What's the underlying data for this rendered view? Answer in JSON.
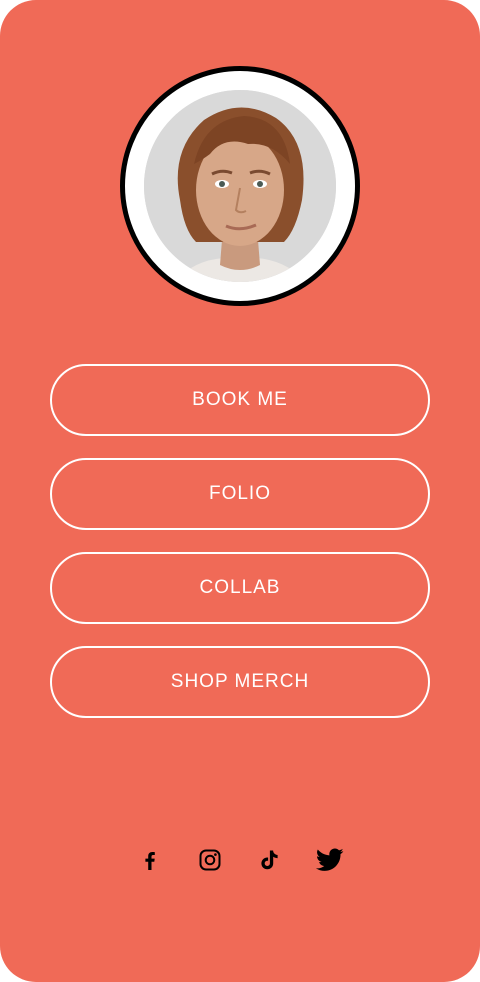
{
  "theme": {
    "background": "#f06a57",
    "foreground": "#ffffff",
    "ring": "#000000"
  },
  "profile": {
    "avatar": "profile-photo"
  },
  "links": [
    {
      "label": "BOOK ME"
    },
    {
      "label": "FOLIO"
    },
    {
      "label": "COLLAB"
    },
    {
      "label": "SHOP MERCH"
    }
  ],
  "socials": [
    {
      "icon": "facebook-icon"
    },
    {
      "icon": "instagram-icon"
    },
    {
      "icon": "tiktok-icon"
    },
    {
      "icon": "twitter-icon"
    }
  ]
}
